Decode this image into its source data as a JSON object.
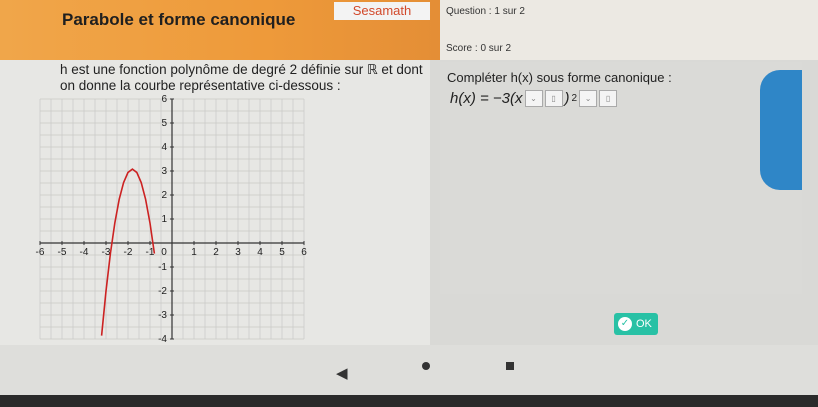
{
  "header": {
    "title": "Parabole et forme canonique",
    "brand": "Sesamath"
  },
  "status": {
    "question_label": "Question : 1 sur 2",
    "score_label": "Score : 0 sur 2"
  },
  "problem": {
    "text": "h est une fonction polynôme de degré 2 définie sur ℝ et dont on donne la courbe représentative ci-dessous :"
  },
  "question": {
    "instruction": "Compléter h(x) sous forme canonique :",
    "lhs": "h(x) = −3(x",
    "exponent": "2"
  },
  "buttons": {
    "ok_label": "OK"
  },
  "chart_data": {
    "type": "line",
    "title": "",
    "xlabel": "",
    "ylabel": "",
    "xlim": [
      -6,
      6
    ],
    "ylim": [
      -4,
      6
    ],
    "x_ticks": [
      -6,
      -5,
      -4,
      -3,
      -2,
      -1,
      0,
      1,
      2,
      3,
      4,
      5,
      6
    ],
    "y_ticks": [
      -4,
      -3,
      -2,
      -1,
      1,
      2,
      3,
      4,
      5,
      6
    ],
    "grid": true,
    "series": [
      {
        "name": "",
        "color": "#cc2222",
        "x": [
          -3.2,
          -3.0,
          -2.8,
          -2.6,
          -2.4,
          -2.2,
          -2.0,
          -1.8,
          -1.6,
          -1.4,
          -1.2,
          -1.0,
          -0.8
        ],
        "y": [
          -3.86,
          -2.0,
          -0.44,
          0.83,
          1.82,
          2.52,
          2.94,
          3.08,
          2.94,
          2.52,
          1.82,
          0.83,
          -0.44
        ]
      }
    ]
  }
}
